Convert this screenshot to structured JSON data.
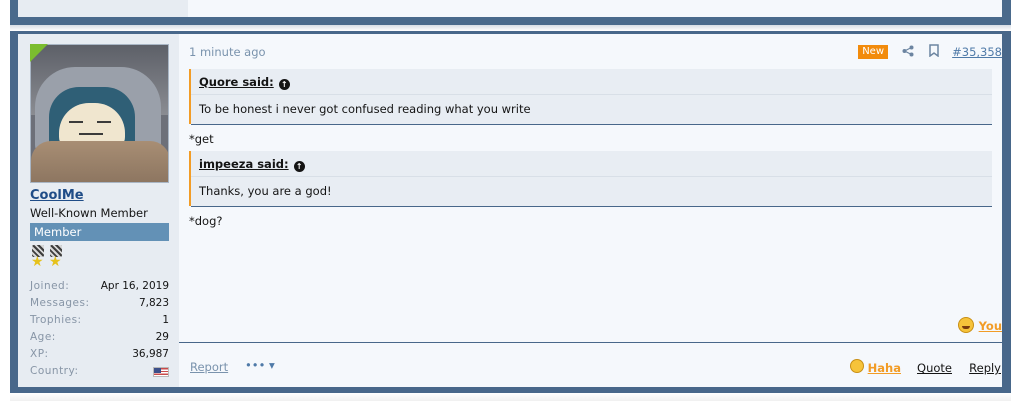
{
  "post": {
    "user": {
      "username": "CoolMe",
      "user_title": "Well-Known Member",
      "banner": "Member",
      "stats": [
        {
          "key": "Joined:",
          "value": "Apr 16, 2019"
        },
        {
          "key": "Messages:",
          "value": "7,823"
        },
        {
          "key": "Trophies:",
          "value": "1"
        },
        {
          "key": "Age:",
          "value": "29"
        },
        {
          "key": "XP:",
          "value": "36,987"
        },
        {
          "key": "Country:",
          "value": ""
        }
      ],
      "country_flag_icon": "us-flag-icon",
      "avatar_icon": "snorlax-avatar"
    },
    "time": "1 minute ago",
    "badge_new": "New",
    "post_number": "#35,358",
    "quotes": [
      {
        "author": "Quore said:",
        "text": "To be honest i never got confused reading what you write"
      },
      {
        "author": "impeeza said:",
        "text": "Thanks, you are a god!"
      }
    ],
    "replies": [
      "*get",
      "*dog?"
    ],
    "reaction": {
      "icon": "laughing-emoji",
      "label": "You"
    },
    "footer": {
      "report": "Report",
      "more": "•••",
      "haha": "Haha",
      "quote": "Quote",
      "reply": "Reply"
    }
  },
  "colors": {
    "post_border": "#48678a",
    "user_col_bg": "#e7ecf2",
    "body_bg": "#f5f8fc",
    "accent_orange": "#f29c26",
    "link_blue": "#1f4c87",
    "banner_blue": "#6391b6",
    "online_green": "#7bbd2f"
  }
}
